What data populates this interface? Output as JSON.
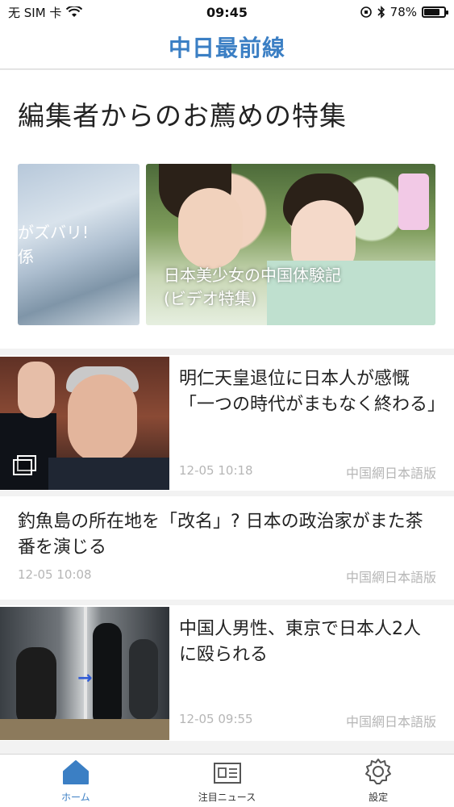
{
  "status_bar": {
    "carrier": "无 SIM 卡",
    "time": "09:45",
    "battery_percent": "78%",
    "battery_level": 0.78
  },
  "header": {
    "title": "中日最前線"
  },
  "featured": {
    "title": "編集者からのお薦めの特集",
    "cards": [
      {
        "line1": "がズバリ!",
        "line2": "係"
      },
      {
        "line1": "日本美少女の中国体験記",
        "line2": "(ビデオ特集)"
      }
    ]
  },
  "articles": [
    {
      "title": "明仁天皇退位に日本人が感慨 「一つの時代がまもなく終わる」",
      "time": "12-05 10:18",
      "source": "中国網日本語版",
      "image": "emperor-waving-photo",
      "icon": "gallery-icon"
    },
    {
      "title": "釣魚島の所在地を「改名」? 日本の政治家がまた茶番を演じる",
      "time": "12-05 10:08",
      "source": "中国網日本語版"
    },
    {
      "title": "中国人男性、東京で日本人2人に殴られる",
      "time": "12-05 09:55",
      "source": "中国網日本語版",
      "image": "train-fight-photo"
    }
  ],
  "tabs": [
    {
      "label": "ホーム",
      "icon": "home-icon",
      "active": true
    },
    {
      "label": "注目ニュース",
      "icon": "news-icon",
      "active": false
    },
    {
      "label": "設定",
      "icon": "gear-icon",
      "active": false
    }
  ],
  "colors": {
    "accent": "#3b7fc4",
    "muted": "#b6b6b6"
  }
}
